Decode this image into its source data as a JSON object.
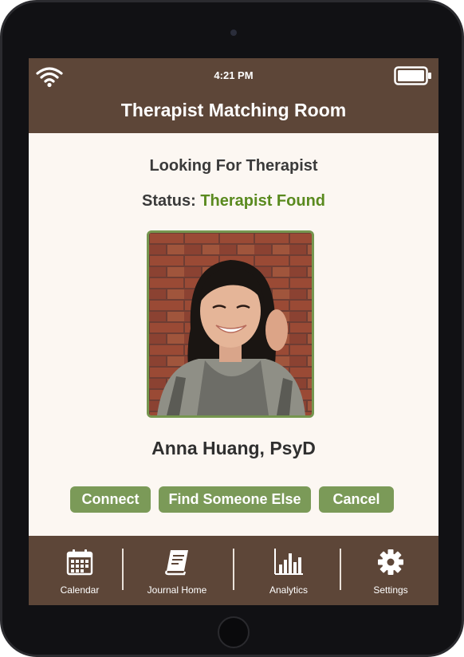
{
  "status_bar": {
    "time": "4:21 PM",
    "wifi_icon": "wifi-icon",
    "battery_icon": "battery-icon"
  },
  "header": {
    "title": "Therapist Matching Room"
  },
  "main": {
    "subtitle": "Looking For Therapist",
    "status_label": "Status:",
    "status_value": "Therapist Found",
    "therapist_name": "Anna Huang, PsyD",
    "photo_icon": "therapist-photo"
  },
  "actions": {
    "connect_label": "Connect",
    "find_label": "Find Someone Else",
    "cancel_label": "Cancel"
  },
  "tabbar": {
    "items": [
      {
        "label": "Calendar",
        "icon": "calendar-icon"
      },
      {
        "label": "Journal Home",
        "icon": "journal-icon"
      },
      {
        "label": "Analytics",
        "icon": "bar-chart-icon"
      },
      {
        "label": "Settings",
        "icon": "gear-icon"
      }
    ]
  },
  "colors": {
    "brand_brown": "#5d4638",
    "button_green": "#7b9a58",
    "status_green": "#5a8a1f",
    "background_cream": "#fcf7f2"
  }
}
